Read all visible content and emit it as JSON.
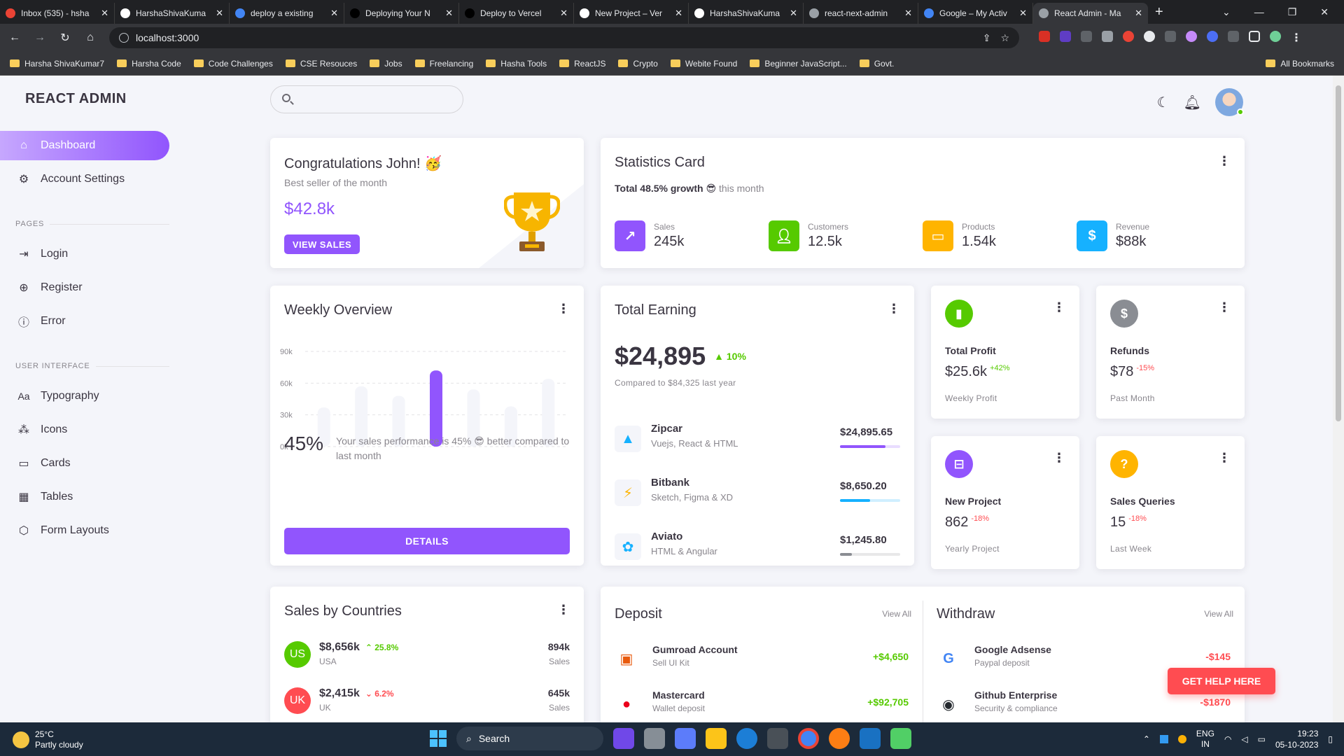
{
  "browser": {
    "tabs": [
      {
        "title": "Inbox (535) - hsha",
        "color": "#ea4335"
      },
      {
        "title": "HarshaShivaKuma",
        "color": "#ffffff"
      },
      {
        "title": "deploy a existing",
        "color": "#4285f4"
      },
      {
        "title": "Deploying Your N",
        "color": "#000000"
      },
      {
        "title": "Deploy to Vercel",
        "color": "#000000"
      },
      {
        "title": "New Project – Ver",
        "color": "#ffffff"
      },
      {
        "title": "HarshaShivaKuma",
        "color": "#ffffff"
      },
      {
        "title": "react-next-admin",
        "color": "#9aa0a6"
      },
      {
        "title": "Google – My Activ",
        "color": "#4285f4"
      },
      {
        "title": "React Admin - Ma",
        "color": "#9aa0a6"
      }
    ],
    "active_tab": 9,
    "url": "localhost:3000",
    "bookmarks": [
      "Harsha ShivaKumar7",
      "Harsha Code",
      "Code  Challenges",
      "CSE Resouces",
      "Jobs",
      "Freelancing",
      "Hasha Tools",
      "ReactJS",
      "Crypto",
      "Webite Found",
      "Beginner JavaScript...",
      "Govt."
    ],
    "all_bookmarks": "All Bookmarks"
  },
  "app": {
    "brand": "REACT ADMIN",
    "nav": {
      "dashboard": "Dashboard",
      "account_settings": "Account Settings",
      "pages_title": "PAGES",
      "login": "Login",
      "register": "Register",
      "error": "Error",
      "ui_title": "USER INTERFACE",
      "typography": "Typography",
      "icons": "Icons",
      "cards": "Cards",
      "tables": "Tables",
      "form_layouts": "Form Layouts"
    },
    "accent": "#9155fd"
  },
  "congrats": {
    "title": "Congratulations John! 🥳",
    "subtitle": "Best seller of the month",
    "amount": "$42.8k",
    "button": "VIEW SALES"
  },
  "statistics": {
    "title": "Statistics Card",
    "growth": "Total 48.5% growth",
    "emoji": "😎",
    "period": "this month",
    "items": [
      {
        "label": "Sales",
        "value": "245k",
        "color": "#9155fd",
        "icon": "trending-up-icon"
      },
      {
        "label": "Customers",
        "value": "12.5k",
        "color": "#56ca00",
        "icon": "user-icon"
      },
      {
        "label": "Products",
        "value": "1.54k",
        "color": "#ffb400",
        "icon": "devices-icon"
      },
      {
        "label": "Revenue",
        "value": "$88k",
        "color": "#16b1ff",
        "icon": "dollar-icon"
      }
    ]
  },
  "weekly": {
    "title": "Weekly Overview",
    "percent": "45%",
    "text": "Your sales performance is 45% 😎 better compared to last month",
    "button": "DETAILS"
  },
  "chart_data": {
    "type": "bar",
    "categories": [
      "",
      "",
      "",
      "",
      "",
      "",
      ""
    ],
    "values": [
      37,
      57,
      48,
      72,
      54,
      38,
      64
    ],
    "highlight_index": 3,
    "ylim": [
      0,
      90
    ],
    "yticks": [
      "90k",
      "60k",
      "30k",
      "0k"
    ],
    "title": "",
    "xlabel": "",
    "ylabel": ""
  },
  "earning": {
    "title": "Total Earning",
    "amount": "$24,895",
    "growth": "10%",
    "compare": "Compared to $84,325 last year",
    "items": [
      {
        "name": "Zipcar",
        "tags": "Vuejs, React & HTML",
        "value": "$24,895.65",
        "progress": 75,
        "color": "#9155fd",
        "icon": "zipcar-icon"
      },
      {
        "name": "Bitbank",
        "tags": "Sketch, Figma & XD",
        "value": "$8,650.20",
        "progress": 50,
        "color": "#16b1ff",
        "icon": "bitbank-icon"
      },
      {
        "name": "Aviato",
        "tags": "HTML & Angular",
        "value": "$1,245.80",
        "progress": 20,
        "color": "#8a8d93",
        "icon": "aviato-icon"
      }
    ]
  },
  "small_cards": [
    {
      "title": "Total Profit",
      "value": "$25.6k",
      "delta": "+42%",
      "delta_color": "#56ca00",
      "sub": "Weekly Profit",
      "color": "#56ca00",
      "icon": "poll-icon"
    },
    {
      "title": "Refunds",
      "value": "$78",
      "delta": "-15%",
      "delta_color": "#ff4c51",
      "sub": "Past Month",
      "color": "#8a8d93",
      "icon": "currency-icon"
    },
    {
      "title": "New Project",
      "value": "862",
      "delta": "-18%",
      "delta_color": "#ff4c51",
      "sub": "Yearly Project",
      "color": "#9155fd",
      "icon": "briefcase-icon"
    },
    {
      "title": "Sales Queries",
      "value": "15",
      "delta": "-18%",
      "delta_color": "#ff4c51",
      "sub": "Last Week",
      "color": "#ffb400",
      "icon": "help-circle-icon"
    }
  ],
  "countries": {
    "title": "Sales by Countries",
    "items": [
      {
        "code": "US",
        "amount": "$8,656k",
        "pct": "25.8%",
        "up": true,
        "name": "USA",
        "num": "894k",
        "lbl": "Sales",
        "color": "#56ca00"
      },
      {
        "code": "UK",
        "amount": "$2,415k",
        "pct": "6.2%",
        "up": false,
        "name": "UK",
        "num": "645k",
        "lbl": "Sales",
        "color": "#ff4c51"
      }
    ]
  },
  "deposit": {
    "title": "Deposit",
    "view_all": "View All",
    "items": [
      {
        "name": "Gumroad Account",
        "sub": "Sell UI Kit",
        "amount": "+$4,650"
      },
      {
        "name": "Mastercard",
        "sub": "Wallet deposit",
        "amount": "+$92,705"
      }
    ]
  },
  "withdraw": {
    "title": "Withdraw",
    "view_all": "View All",
    "items": [
      {
        "name": "Google Adsense",
        "sub": "Paypal deposit",
        "amount": "-$145"
      },
      {
        "name": "Github Enterprise",
        "sub": "Security & compliance",
        "amount": "-$1870"
      }
    ]
  },
  "help_button": "GET HELP HERE",
  "taskbar": {
    "temp": "25°C",
    "weather": "Partly cloudy",
    "search": "Search",
    "lang1": "ENG",
    "lang2": "IN",
    "time": "19:23",
    "date": "05-10-2023"
  }
}
